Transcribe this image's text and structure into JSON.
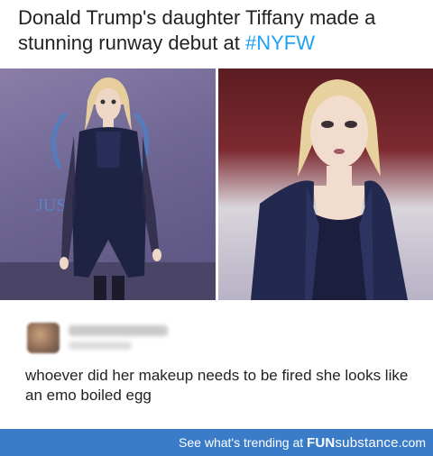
{
  "post": {
    "headline": "Donald Trump's daughter Tiffany made a stunning runway debut at ",
    "hashtag": "#NYFW",
    "left_photo": {
      "backdrop_text": "JUS"
    }
  },
  "comment": {
    "text": "whoever did her makeup needs to be fired she looks like an emo boiled egg"
  },
  "footer": {
    "cta": "See what's trending at ",
    "brand_bold": "FUN",
    "brand_rest": "substance",
    "brand_tld": ".com"
  },
  "colors": {
    "hashtag": "#1da1f2",
    "footer_bg": "#3b7cc8"
  }
}
